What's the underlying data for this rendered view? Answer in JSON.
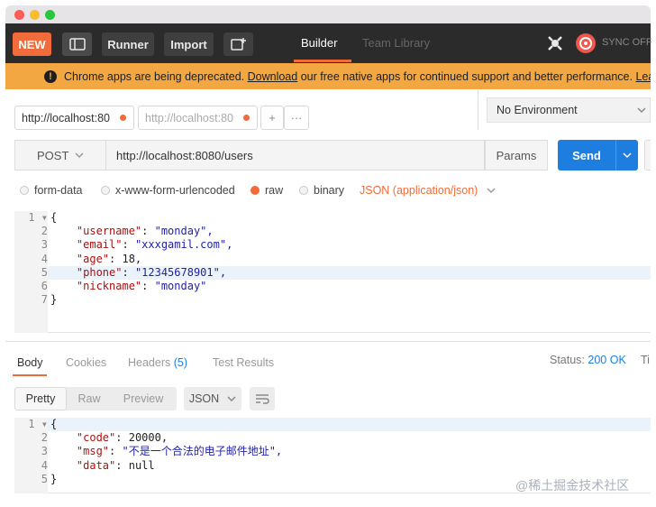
{
  "toolbar": {
    "new_label": "NEW",
    "runner_label": "Runner",
    "import_label": "Import",
    "builder_label": "Builder",
    "team_library_label": "Team Library",
    "sync_label": "SYNC OFF"
  },
  "banner": {
    "text_before": "Chrome apps are being deprecated.",
    "link_text": "Download",
    "text_after": "our free native apps for continued support and better performance.",
    "learn_link": "Learn"
  },
  "request_tabs": [
    {
      "label": "http://localhost:80"
    },
    {
      "label": "http://localhost:80"
    }
  ],
  "add_tab_label": "+",
  "more_tabs_label": "···",
  "environment": {
    "selected": "No Environment"
  },
  "request": {
    "method": "POST",
    "url": "http://localhost:8080/users",
    "params_label": "Params",
    "send_label": "Send"
  },
  "body_types": [
    {
      "label": "form-data",
      "selected": false
    },
    {
      "label": "x-www-form-urlencoded",
      "selected": false
    },
    {
      "label": "raw",
      "selected": true
    },
    {
      "label": "binary",
      "selected": false
    }
  ],
  "content_type": "JSON (application/json)",
  "request_body": {
    "line_numbers": [
      "1",
      "2",
      "3",
      "4",
      "5",
      "6",
      "7"
    ],
    "lines": [
      {
        "k": "",
        "sep": "",
        "v": "{",
        "indent": ""
      },
      {
        "k": "\"username\"",
        "sep": ": ",
        "v": "\"monday\",",
        "indent": "    "
      },
      {
        "k": "\"email\"",
        "sep": ": ",
        "v": "\"xxxgamil.com\",",
        "indent": "    "
      },
      {
        "k": "\"age\"",
        "sep": ": ",
        "v": "18,",
        "indent": "    "
      },
      {
        "k": "\"phone\"",
        "sep": ": ",
        "v": "\"12345678901\",",
        "indent": "    "
      },
      {
        "k": "\"nickname\"",
        "sep": ": ",
        "v": "\"monday\"",
        "indent": "    "
      },
      {
        "k": "",
        "sep": "",
        "v": "}",
        "indent": ""
      }
    ]
  },
  "response": {
    "tabs": [
      "Body",
      "Cookies",
      "Headers",
      "Test Results"
    ],
    "headers_count": "(5)",
    "status_label": "Status:",
    "status_value": "200 OK",
    "time_label": "Ti",
    "view_modes": [
      "Pretty",
      "Raw",
      "Preview"
    ],
    "format": "JSON",
    "line_numbers": [
      "1",
      "2",
      "3",
      "4",
      "5"
    ],
    "lines": [
      {
        "k": "",
        "sep": "",
        "v": "{",
        "indent": ""
      },
      {
        "k": "\"code\"",
        "sep": ": ",
        "v": "20000,",
        "indent": "    "
      },
      {
        "k": "\"msg\"",
        "sep": ": ",
        "v": "\"不是一个合法的电子邮件地址\",",
        "indent": "    "
      },
      {
        "k": "\"data\"",
        "sep": ": ",
        "v": "null",
        "indent": "    "
      },
      {
        "k": "",
        "sep": "",
        "v": "}",
        "indent": ""
      }
    ]
  },
  "watermark": "@稀土掘金技术社区",
  "colors": {
    "accent_orange": "#f26b3a",
    "send_blue": "#1d7ee0",
    "banner_orange": "#f3a742",
    "status_blue": "#1d7ee0"
  },
  "icons": [
    "layout-toggle-icon",
    "new-window-icon",
    "satellite-icon",
    "sync-icon",
    "chevron-down-icon",
    "warning-icon",
    "wrap-lines-icon"
  ]
}
